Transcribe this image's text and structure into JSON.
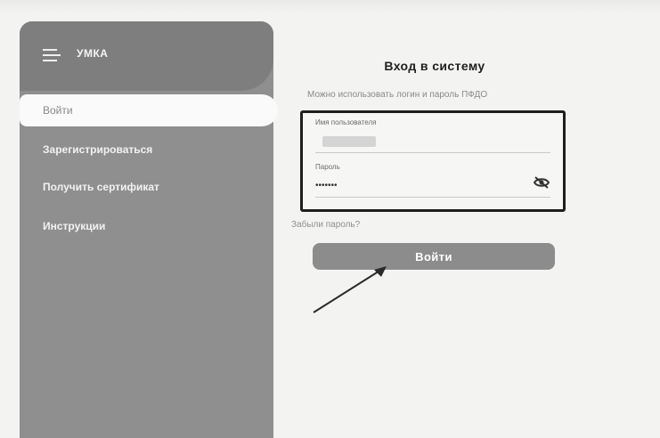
{
  "app": {
    "title": "УМКА"
  },
  "sidebar": {
    "items": [
      {
        "label": "Войти"
      },
      {
        "label": "Зарегистрироваться"
      },
      {
        "label": "Получить сертификат"
      },
      {
        "label": "Инструкции"
      }
    ]
  },
  "login": {
    "title": "Вход в систему",
    "hint": "Можно использовать логин и пароль ПФДО",
    "username_label": "Имя пользователя",
    "username_value": "",
    "password_label": "Пароль",
    "password_value": "•••••••",
    "forgot_link": "Забыли пароль?",
    "submit_label": "Войти"
  },
  "icons": {
    "menu": "hamburger-menu-icon",
    "password_toggle": "eye-slash-icon"
  },
  "colors": {
    "sidebar": "#8f8f8f",
    "sidebar_header": "#7e7e7e",
    "button": "#8c8c8c",
    "highlight_border": "#1e1e1e"
  }
}
